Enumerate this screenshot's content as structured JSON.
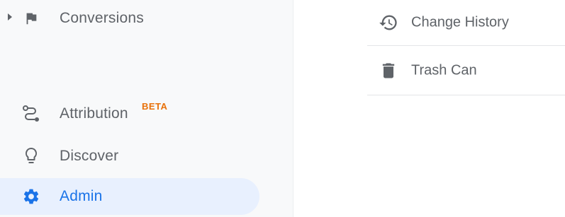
{
  "sidebar": {
    "items": [
      {
        "label": "Conversions",
        "icon": "flag-icon",
        "expandable": true
      },
      {
        "label": "Attribution",
        "icon": "route-icon",
        "badge": "BETA"
      },
      {
        "label": "Discover",
        "icon": "lightbulb-icon"
      },
      {
        "label": "Admin",
        "icon": "gear-icon",
        "active": true
      }
    ]
  },
  "panel": {
    "items": [
      {
        "label": "Change History",
        "icon": "history-icon"
      },
      {
        "label": "Trash Can",
        "icon": "trash-icon"
      }
    ]
  },
  "colors": {
    "sidebar_bg": "#f8f9fa",
    "text": "#5f6368",
    "accent": "#1a73e8",
    "active_bg": "#e8f0fe",
    "beta": "#e8710a"
  }
}
